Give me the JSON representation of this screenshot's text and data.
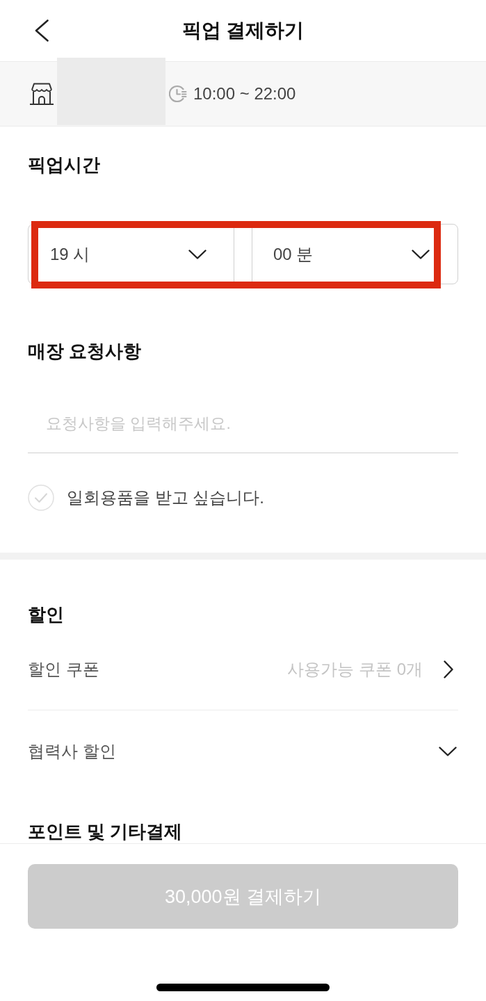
{
  "header": {
    "title": "픽업 결제하기"
  },
  "store": {
    "hours": "10:00 ~ 22:00"
  },
  "pickup_time": {
    "title": "픽업시간",
    "highlighted": true,
    "selects": [
      {
        "value": "19 시"
      },
      {
        "value": "00 분"
      }
    ]
  },
  "store_request": {
    "title": "매장 요청사항",
    "placeholder": "요청사항을 입력해주세요.",
    "option": {
      "label": "일회용품을 받고 싶습니다.",
      "checked": false
    }
  },
  "discount": {
    "title": "할인",
    "rows": [
      {
        "kind": "link",
        "label": "할인 쿠폰",
        "value": "사용가능 쿠폰 0개"
      },
      {
        "kind": "dropdown",
        "label": "협력사 할인",
        "expanded": false
      }
    ]
  },
  "points": {
    "title": "포인트 및 기타결제"
  },
  "pay_button": {
    "label": "30,000원 결제하기",
    "disabled": true
  }
}
